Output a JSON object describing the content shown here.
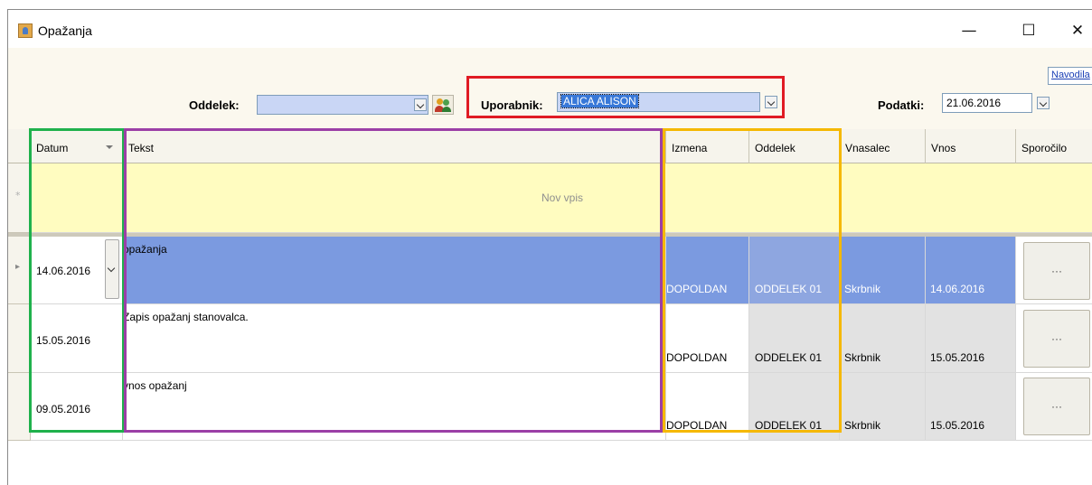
{
  "window": {
    "title": "Opažanja",
    "minimize": "—",
    "maximize": "☐",
    "close": "✕"
  },
  "toolbar": {
    "navodila": "Navodila",
    "oddelek_label": "Oddelek:",
    "oddelek_value": "",
    "uporabnik_label": "Uporabnik:",
    "uporabnik_value": "ALICA ALISON",
    "podatki_label": "Podatki:",
    "podatki_value": "21.06.2016"
  },
  "grid": {
    "columns": [
      "Datum",
      "Tekst",
      "Izmena",
      "Oddelek",
      "Vnasalec",
      "Vnos",
      "Sporočilo"
    ],
    "new_row_text": "Nov vpis",
    "new_row_marker": "*",
    "current_row_marker": "▸",
    "rows": [
      {
        "datum": "14.06.2016",
        "tekst": "opažanja",
        "izmena": "DOPOLDAN",
        "oddelek": "ODDELEK 01",
        "vnasalec": "Skrbnik",
        "vnos": "14.06.2016",
        "sporocilo": "···"
      },
      {
        "datum": "15.05.2016",
        "tekst": "Zapis opažanj stanovalca.",
        "izmena": "DOPOLDAN",
        "oddelek": "ODDELEK 01",
        "vnasalec": "Skrbnik",
        "vnos": "15.05.2016",
        "sporocilo": "···"
      },
      {
        "datum": "09.05.2016",
        "tekst": "vnos opažanj",
        "izmena": "DOPOLDAN",
        "oddelek": "ODDELEK 01",
        "vnasalec": "Skrbnik",
        "vnos": "15.05.2016",
        "sporocilo": "···"
      }
    ]
  },
  "colors": {
    "highlight_user": "#e01b24",
    "highlight_date": "#1fb14c",
    "highlight_text": "#9b3fa6",
    "highlight_fields": "#f5b800",
    "selected_row": "#7b9ae0",
    "new_row": "#fffcc0"
  }
}
